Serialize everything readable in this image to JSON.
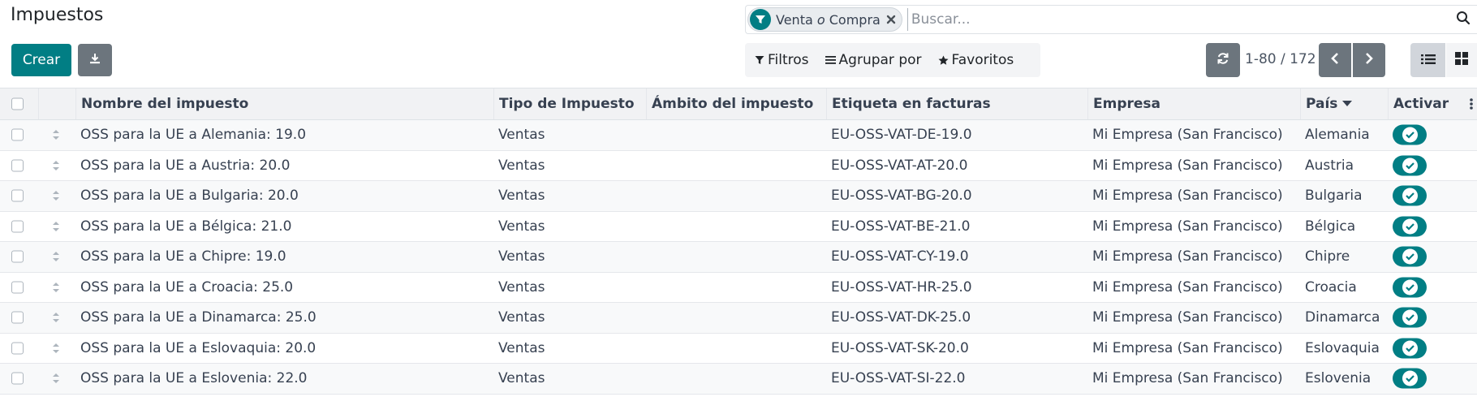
{
  "page": {
    "title": "Impuestos"
  },
  "search": {
    "facet": {
      "part1": "Venta",
      "separator": "o",
      "part2": "Compra"
    },
    "placeholder": "Buscar..."
  },
  "toolbar": {
    "create_label": "Crear",
    "filters_label": "Filtros",
    "groupby_label": "Agrupar por",
    "favorites_label": "Favoritos"
  },
  "pager": {
    "value": "1-80 / 172"
  },
  "colors": {
    "accent": "#017e84",
    "secondary": "#6c757d"
  },
  "table": {
    "columns": [
      "Nombre del impuesto",
      "Tipo de Impuesto",
      "Ámbito del impuesto",
      "Etiqueta en facturas",
      "Empresa",
      "País",
      "Activar"
    ],
    "rows": [
      {
        "name": "OSS para la UE a Alemania: 19.0",
        "type": "Ventas",
        "scope": "",
        "label": "EU-OSS-VAT-DE-19.0",
        "company": "Mi Empresa (San Francisco)",
        "country": "Alemania",
        "active": true
      },
      {
        "name": "OSS para la UE a Austria: 20.0",
        "type": "Ventas",
        "scope": "",
        "label": "EU-OSS-VAT-AT-20.0",
        "company": "Mi Empresa (San Francisco)",
        "country": "Austria",
        "active": true
      },
      {
        "name": "OSS para la UE a Bulgaria: 20.0",
        "type": "Ventas",
        "scope": "",
        "label": "EU-OSS-VAT-BG-20.0",
        "company": "Mi Empresa (San Francisco)",
        "country": "Bulgaria",
        "active": true
      },
      {
        "name": "OSS para la UE a Bélgica: 21.0",
        "type": "Ventas",
        "scope": "",
        "label": "EU-OSS-VAT-BE-21.0",
        "company": "Mi Empresa (San Francisco)",
        "country": "Bélgica",
        "active": true
      },
      {
        "name": "OSS para la UE a Chipre: 19.0",
        "type": "Ventas",
        "scope": "",
        "label": "EU-OSS-VAT-CY-19.0",
        "company": "Mi Empresa (San Francisco)",
        "country": "Chipre",
        "active": true
      },
      {
        "name": "OSS para la UE a Croacia: 25.0",
        "type": "Ventas",
        "scope": "",
        "label": "EU-OSS-VAT-HR-25.0",
        "company": "Mi Empresa (San Francisco)",
        "country": "Croacia",
        "active": true
      },
      {
        "name": "OSS para la UE a Dinamarca: 25.0",
        "type": "Ventas",
        "scope": "",
        "label": "EU-OSS-VAT-DK-25.0",
        "company": "Mi Empresa (San Francisco)",
        "country": "Dinamarca",
        "active": true
      },
      {
        "name": "OSS para la UE a Eslovaquia: 20.0",
        "type": "Ventas",
        "scope": "",
        "label": "EU-OSS-VAT-SK-20.0",
        "company": "Mi Empresa (San Francisco)",
        "country": "Eslovaquia",
        "active": true
      },
      {
        "name": "OSS para la UE a Eslovenia: 22.0",
        "type": "Ventas",
        "scope": "",
        "label": "EU-OSS-VAT-SI-22.0",
        "company": "Mi Empresa (San Francisco)",
        "country": "Eslovenia",
        "active": true
      }
    ]
  }
}
